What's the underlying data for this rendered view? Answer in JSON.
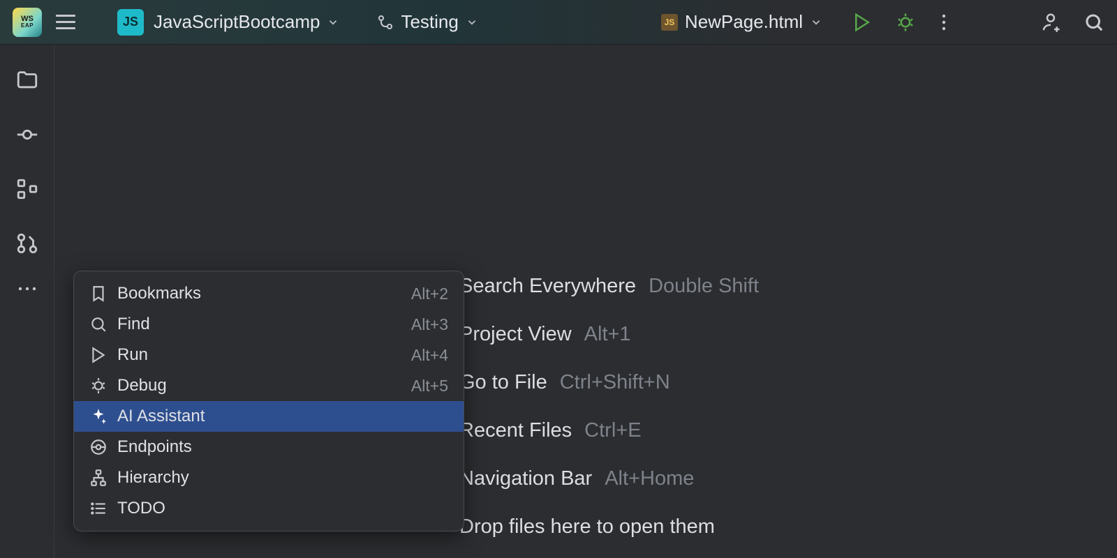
{
  "topbar": {
    "app_logo": {
      "line1": "WS",
      "line2": "EAP"
    },
    "project_badge": "JS",
    "project_name": "JavaScriptBootcamp",
    "run_config": "Testing",
    "file_icon": "JS",
    "current_file": "NewPage.html"
  },
  "leftRail": {
    "tools": [
      {
        "name": "project-tool",
        "icon": "folder"
      },
      {
        "name": "commit-tool",
        "icon": "commit"
      },
      {
        "name": "structure-tool",
        "icon": "structure"
      },
      {
        "name": "pull-requests-tool",
        "icon": "pr"
      },
      {
        "name": "more-tool",
        "icon": "dots"
      }
    ]
  },
  "popup": {
    "items": [
      {
        "icon": "bookmark",
        "label": "Bookmarks",
        "shortcut": "Alt+2",
        "selected": false
      },
      {
        "icon": "search",
        "label": "Find",
        "shortcut": "Alt+3",
        "selected": false
      },
      {
        "icon": "play",
        "label": "Run",
        "shortcut": "Alt+4",
        "selected": false
      },
      {
        "icon": "bug",
        "label": "Debug",
        "shortcut": "Alt+5",
        "selected": false
      },
      {
        "icon": "sparkle",
        "label": "AI Assistant",
        "shortcut": "",
        "selected": true
      },
      {
        "icon": "endpoint",
        "label": "Endpoints",
        "shortcut": "",
        "selected": false
      },
      {
        "icon": "hierarchy",
        "label": "Hierarchy",
        "shortcut": "",
        "selected": false
      },
      {
        "icon": "list",
        "label": "TODO",
        "shortcut": "",
        "selected": false
      }
    ]
  },
  "welcome": {
    "items": [
      {
        "label": "Search Everywhere",
        "hint": "Double Shift"
      },
      {
        "label": "Project View",
        "hint": "Alt+1"
      },
      {
        "label": "Go to File",
        "hint": "Ctrl+Shift+N"
      },
      {
        "label": "Recent Files",
        "hint": "Ctrl+E"
      },
      {
        "label": "Navigation Bar",
        "hint": "Alt+Home"
      },
      {
        "label": "Drop files here to open them",
        "hint": ""
      }
    ]
  }
}
